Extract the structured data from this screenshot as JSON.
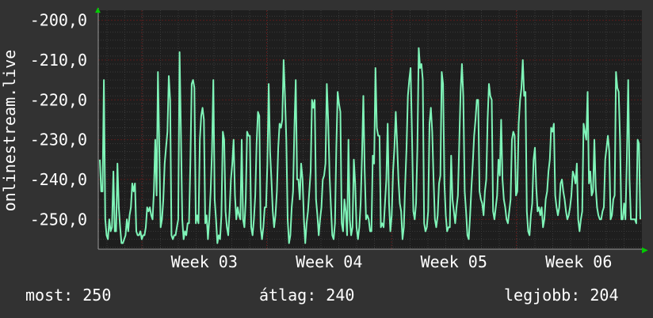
{
  "chart_data": {
    "type": "line",
    "title": "",
    "ylabel": "onlinestream.live",
    "xlabel": "",
    "ylim": [
      -257.5,
      -197.5
    ],
    "y_ticks": [
      {
        "value": -200,
        "label": "-200,0"
      },
      {
        "value": -210,
        "label": "-210,0"
      },
      {
        "value": -220,
        "label": "-220,0"
      },
      {
        "value": -230,
        "label": "-230,0"
      },
      {
        "value": -240,
        "label": "-240,0"
      },
      {
        "value": -250,
        "label": "-250,0"
      }
    ],
    "x_ticks": [
      "Week 03",
      "Week 04",
      "Week 05",
      "Week 06"
    ],
    "grid": true,
    "colors": {
      "background": "#323232",
      "plot_background": "#1e1e1e",
      "line": "#7ff4b8",
      "grid_major": "#5a1a1a",
      "grid_minor": "#3a3a3a",
      "axis_arrow": "#00cc00"
    },
    "series": [
      {
        "values": [
          -235,
          -243,
          -243,
          -215,
          -250,
          -254,
          -255,
          -250,
          -253,
          -252,
          -238,
          -253,
          -253,
          -236,
          -247,
          -252,
          -256,
          -256,
          -255,
          -254,
          -250,
          -253,
          -249,
          -247,
          -241,
          -243,
          -241,
          -253,
          -254,
          -254,
          -253,
          -255,
          -254,
          -254,
          -252,
          -247,
          -248,
          -247,
          -249,
          -250,
          -243,
          -230,
          -244,
          -213,
          -232,
          -252,
          -250,
          -245,
          -236,
          -232,
          -228,
          -214,
          -220,
          -254,
          -255,
          -254,
          -254,
          -252,
          -250,
          -208,
          -228,
          -250,
          -255,
          -253,
          -254,
          -251,
          -251,
          -236,
          -216,
          -215,
          -217,
          -251,
          -249,
          -251,
          -230,
          -224,
          -222,
          -225,
          -251,
          -249,
          -255,
          -250,
          -243,
          -233,
          -215,
          -245,
          -250,
          -256,
          -254,
          -255,
          -249,
          -228,
          -230,
          -248,
          -252,
          -254,
          -248,
          -240,
          -236,
          -230,
          -244,
          -250,
          -247,
          -249,
          -250,
          -230,
          -250,
          -252,
          -245,
          -228,
          -229,
          -229,
          -252,
          -254,
          -250,
          -244,
          -231,
          -223,
          -224,
          -252,
          -255,
          -252,
          -247,
          -247,
          -236,
          -216,
          -233,
          -240,
          -248,
          -252,
          -249,
          -243,
          -232,
          -226,
          -227,
          -225,
          -210,
          -219,
          -230,
          -250,
          -256,
          -254,
          -247,
          -243,
          -227,
          -215,
          -240,
          -240,
          -245,
          -236,
          -240,
          -250,
          -256,
          -251,
          -248,
          -243,
          -238,
          -220,
          -222,
          -220,
          -245,
          -249,
          -254,
          -250,
          -247,
          -240,
          -239,
          -236,
          -216,
          -225,
          -239,
          -247,
          -254,
          -255,
          -251,
          -232,
          -218,
          -221,
          -223,
          -251,
          -253,
          -245,
          -248,
          -254,
          -230,
          -250,
          -254,
          -252,
          -235,
          -241,
          -252,
          -255,
          -252,
          -246,
          -234,
          -219,
          -238,
          -250,
          -249,
          -250,
          -253,
          -253,
          -234,
          -236,
          -212,
          -227,
          -229,
          -229,
          -252,
          -251,
          -252,
          -246,
          -240,
          -226,
          -246,
          -253,
          -249,
          -238,
          -232,
          -223,
          -231,
          -240,
          -246,
          -248,
          -255,
          -252,
          -241,
          -232,
          -219,
          -215,
          -212,
          -229,
          -248,
          -250,
          -246,
          -232,
          -207,
          -212,
          -211,
          -215,
          -251,
          -253,
          -252,
          -248,
          -226,
          -222,
          -228,
          -240,
          -250,
          -252,
          -249,
          -241,
          -239,
          -213,
          -216,
          -241,
          -249,
          -253,
          -252,
          -252,
          -234,
          -245,
          -248,
          -251,
          -247,
          -244,
          -231,
          -218,
          -211,
          -219,
          -243,
          -248,
          -254,
          -255,
          -249,
          -242,
          -236,
          -229,
          -225,
          -220,
          -220,
          -243,
          -245,
          -246,
          -249,
          -243,
          -240,
          -225,
          -216,
          -219,
          -220,
          -248,
          -250,
          -247,
          -244,
          -235,
          -239,
          -225,
          -240,
          -245,
          -247,
          -250,
          -251,
          -248,
          -245,
          -230,
          -228,
          -229,
          -244,
          -243,
          -226,
          -220,
          -217,
          -210,
          -219,
          -218,
          -248,
          -253,
          -254,
          -249,
          -246,
          -235,
          -232,
          -242,
          -248,
          -247,
          -249,
          -247,
          -252,
          -250,
          -245,
          -243,
          -238,
          -235,
          -227,
          -228,
          -226,
          -244,
          -247,
          -249,
          -247,
          -241,
          -240,
          -243,
          -245,
          -248,
          -250,
          -249,
          -247,
          -244,
          -238,
          -239,
          -241,
          -236,
          -250,
          -253,
          -250,
          -248,
          -226,
          -228,
          -230,
          -218,
          -241,
          -238,
          -244,
          -243,
          -230,
          -242,
          -247,
          -249,
          -250,
          -250,
          -248,
          -247,
          -235,
          -232,
          -229,
          -233,
          -250,
          -249,
          -245,
          -244,
          -213,
          -217,
          -218,
          -230,
          -250,
          -250,
          -246,
          -250,
          -235,
          -215,
          -240,
          -250,
          -250,
          -250,
          -250,
          -251,
          -230,
          -231,
          -250
        ]
      }
    ],
    "arrow_glyph_up": "▲",
    "arrow_glyph_right": "▶"
  },
  "stats": {
    "current_label": "most:",
    "current_value": "250",
    "average_label": "átlag:",
    "average_value": "240",
    "best_label": "legjobb:",
    "best_value": "204"
  }
}
